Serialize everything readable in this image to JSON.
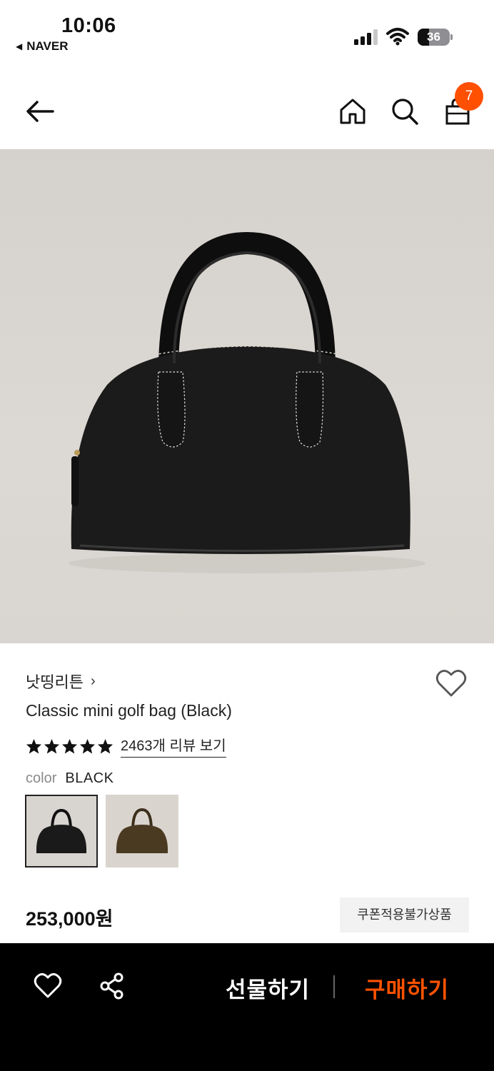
{
  "status_bar": {
    "time": "10:06",
    "back_app": "NAVER",
    "battery": "36",
    "battery_level": 0.36
  },
  "header": {
    "cart_count": "7"
  },
  "product": {
    "brand": "낫띵리튼",
    "title": "Classic mini golf bag (Black)",
    "stars": 5,
    "review_link": "2463개 리뷰 보기",
    "color_label": "color",
    "color_value": "BLACK",
    "swatches": [
      "black",
      "brown"
    ],
    "price": "253,000원",
    "coupon_note": "쿠폰적용불가상품"
  },
  "bottom_bar": {
    "gift_label": "선물하기",
    "buy_label": "구매하기"
  },
  "colors": {
    "accent": "#ff4f00",
    "buy_text": "#ff5200",
    "bag_black": "#1a1a1a",
    "bag_brown": "#4a3a22"
  }
}
